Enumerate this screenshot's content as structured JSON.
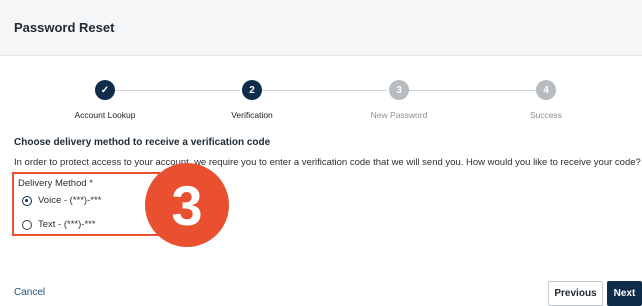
{
  "header": {
    "title": "Password Reset"
  },
  "stepper": {
    "steps": [
      {
        "label": "Account Lookup",
        "status": "done",
        "marker": "✓"
      },
      {
        "label": "Verification",
        "status": "active",
        "marker": "2"
      },
      {
        "label": "New Password",
        "status": "pending",
        "marker": "3"
      },
      {
        "label": "Success",
        "status": "pending",
        "marker": "4"
      }
    ]
  },
  "section": {
    "title": "Choose delivery method to receive a verification code",
    "description": "In order to protect access to your account, we require you to enter a verification code that we will send you. How would you like to receive your code?"
  },
  "delivery": {
    "label": "Delivery Method *",
    "options": [
      {
        "label": "Voice - (***)-***",
        "checked": true
      },
      {
        "label": "Text - (***)-***",
        "checked": false
      }
    ]
  },
  "annotation": {
    "badge_number": "3",
    "color": "#e8502f"
  },
  "footer": {
    "cancel_label": "Cancel",
    "previous_label": "Previous",
    "next_label": "Next"
  },
  "colors": {
    "primary": "#0f2c4a",
    "pending": "#b7bcc0",
    "highlight": "#e8502f"
  }
}
